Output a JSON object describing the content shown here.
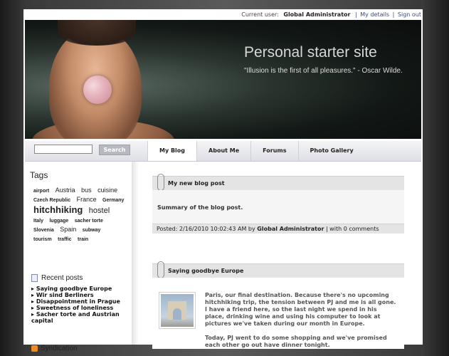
{
  "topbar": {
    "current_user_label": "Current user:",
    "user_name": "Global Administrator",
    "my_details": "My details",
    "sign_out": "Sign out"
  },
  "header": {
    "title": "Personal starter site",
    "quote": "\"Illusion is the first of all pleasures.\" - Oscar Wilde."
  },
  "nav": {
    "search_placeholder": "",
    "search_button": "Search",
    "tabs": [
      {
        "label": "My Blog",
        "active": true
      },
      {
        "label": "About Me",
        "active": false
      },
      {
        "label": "Forums",
        "active": false
      },
      {
        "label": "Photo Gallery",
        "active": false
      }
    ]
  },
  "sidebar": {
    "tags_title": "Tags",
    "tags": [
      "airport",
      "Austria",
      "bus",
      "cuisine",
      "Czech Republic",
      "France",
      "Germany",
      "hitchhiking",
      "hostel",
      "Italy",
      "luggage",
      "sacher torte",
      "Slovenia",
      "Spain",
      "subway",
      "tourism",
      "traffic",
      "train"
    ],
    "recent_title": "Recent posts",
    "recent_posts": [
      "Saying goodbye Europe",
      "Wir sind Berliners",
      "Disappointment in Prague",
      "Sweetness of loneliness",
      "Sacher torte and Austrian capital"
    ],
    "syndication_title": "Syndication"
  },
  "posts": [
    {
      "title": "My new blog post",
      "summary": "Summary of the blog post.",
      "footer_posted": "Posted: 2/16/2010 10:02:43 AM by",
      "footer_author": "Global Administrator",
      "footer_comments": "| with 0 comments"
    },
    {
      "title": "Saying goodbye Europe",
      "paragraph1": "Paris, our final destination. Because there's no upcoming hitchhiking trip, the tension between PJ and me is all gone. I have a friend here, so the last night we spend in his place, drinking wine and using his computer to look at pictures we've taken during our month in Europe.",
      "paragraph2": "Today, PJ went to do some shopping and we've promised each other go out have dinner tonight."
    }
  ],
  "colors": {
    "accent_link": "#3a4a7a",
    "rss": "#f08a24"
  }
}
